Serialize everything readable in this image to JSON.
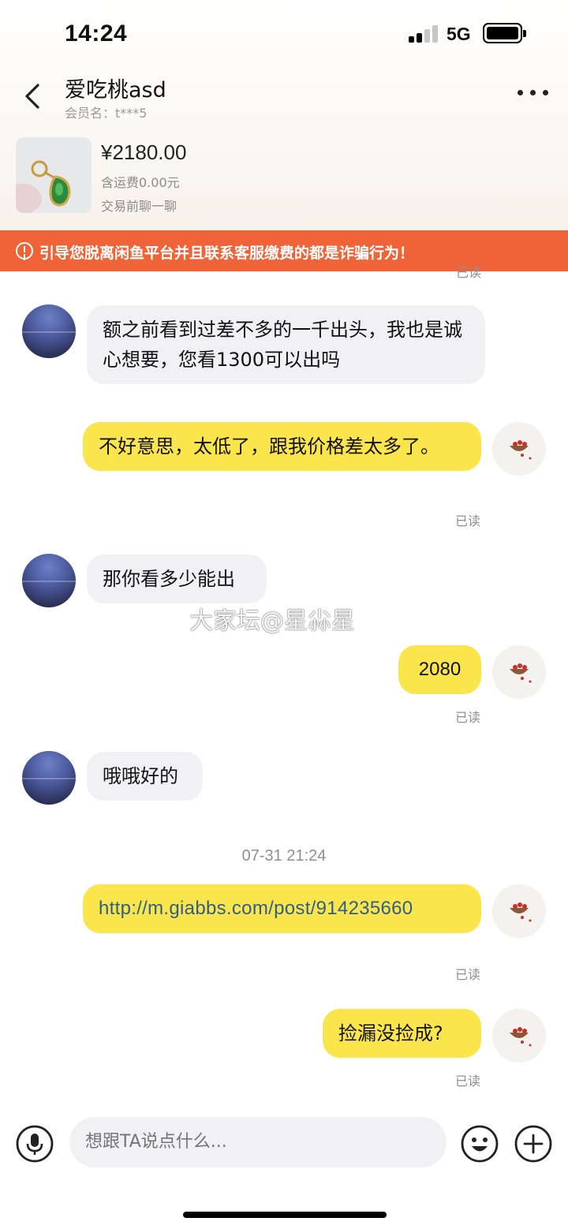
{
  "status": {
    "time": "14:24",
    "network": "5G"
  },
  "nav": {
    "title": "爱吃桃asd",
    "subtitle": "会员名：t***5"
  },
  "product": {
    "price": "¥2180.00",
    "shipping": "含运费0.00元",
    "chat_hint": "交易前聊一聊"
  },
  "warning": {
    "text": "引导您脱离闲鱼平台并且联系客服缴费的都是诈骗行为！"
  },
  "chat": {
    "partial_read": "已读",
    "messages": [
      {
        "sender": "peer",
        "text": "额之前看到过差不多的一千出头，我也是诚心想要，您看1300可以出吗"
      },
      {
        "sender": "me",
        "text": "不好意思，太低了，跟我价格差太多了。",
        "status": "已读"
      },
      {
        "sender": "peer",
        "text": "那你看多少能出"
      },
      {
        "sender": "me",
        "text": "2080",
        "status": "已读"
      },
      {
        "sender": "peer",
        "text": "哦哦好的"
      },
      {
        "sender": "me",
        "text": "http://m.giabbs.com/post/914235660",
        "status": "已读"
      },
      {
        "sender": "me",
        "text": "捡漏没捡成?",
        "status": "已读"
      }
    ],
    "timestamp": "07-31 21:24",
    "watermark": "大家坛@星尛星"
  },
  "input": {
    "placeholder": "想跟TA说点什么..."
  },
  "colors": {
    "accent_yellow": "#fbe54c",
    "warning_orange": "#ee6438",
    "peer_bubble": "#f1f1f3"
  },
  "icons": [
    "back-icon",
    "more-icon",
    "mic-icon",
    "emoji-icon",
    "plus-icon"
  ]
}
